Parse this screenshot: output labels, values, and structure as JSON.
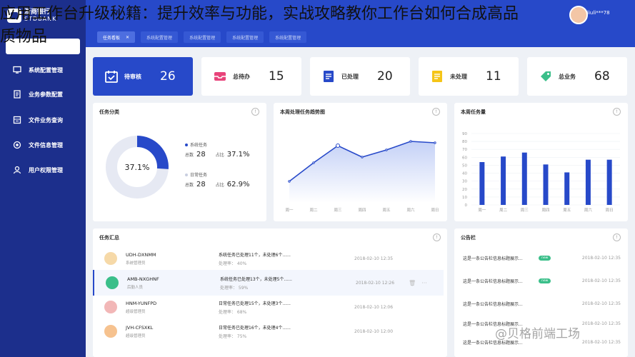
{
  "headline": {
    "line1": "应用工作台升级秘籍：提升效率与功能，实战攻略教你工作台如何合成高品",
    "line2": "质物品"
  },
  "brand": {
    "name_cn": "浙商银行",
    "name_en": "STDBANK"
  },
  "sidebar": {
    "items": [
      {
        "label": "系统配置管理",
        "icon": "monitor-icon"
      },
      {
        "label": "业务参数配置",
        "icon": "document-icon"
      },
      {
        "label": "文件业务查询",
        "icon": "folder-icon"
      },
      {
        "label": "文件信息管理",
        "icon": "target-icon"
      },
      {
        "label": "用户权限管理",
        "icon": "user-icon"
      }
    ]
  },
  "tabs": [
    {
      "label": "任务看板",
      "close": "✕"
    },
    {
      "label": "系统配置管理"
    },
    {
      "label": "系统配置管理"
    },
    {
      "label": "系统配置管理"
    },
    {
      "label": "系统配置管理"
    }
  ],
  "user": {
    "name": "liuli***78"
  },
  "stats": [
    {
      "label": "待审核",
      "value": "26",
      "icon": "check-calendar-icon"
    },
    {
      "label": "总待办",
      "value": "15",
      "icon": "inbox-icon"
    },
    {
      "label": "已处理",
      "value": "20",
      "icon": "processed-icon"
    },
    {
      "label": "未处理",
      "value": "11",
      "icon": "pending-icon"
    },
    {
      "label": "总业务",
      "value": "68",
      "icon": "tag-icon"
    }
  ],
  "category": {
    "title": "任务分类",
    "center": "37.1%",
    "groups": [
      {
        "name": "系统任务",
        "total_label": "总数",
        "total": "28",
        "pct_label": "占比",
        "pct": "37.1%"
      },
      {
        "name": "日常任务",
        "total_label": "总数",
        "total": "28",
        "pct_label": "占比",
        "pct": "62.9%"
      }
    ]
  },
  "colors": {
    "primary": "#2749c9",
    "sidebar": "#1c2f8c",
    "donut_rest": "#e6e9f3",
    "success": "#3bbf8a"
  },
  "trend": {
    "title": "本周处理任务趋势图"
  },
  "volume": {
    "title": "本周任务量"
  },
  "chart_data": [
    {
      "type": "area",
      "x": [
        "周一",
        "周二",
        "周三",
        "周四",
        "周五",
        "周六",
        "周日"
      ],
      "values": [
        35,
        48,
        60,
        52,
        57,
        63,
        62
      ]
    },
    {
      "type": "bar",
      "categories": [
        "周一",
        "周二",
        "周三",
        "周四",
        "周五",
        "周六",
        "周日"
      ],
      "values": [
        54,
        61,
        66,
        51,
        41,
        57,
        57
      ],
      "yticks": [
        "0",
        "10",
        "20",
        "30",
        "40",
        "50",
        "60",
        "70",
        "80",
        "90"
      ],
      "ylim": [
        0,
        90
      ]
    }
  ],
  "tasks": {
    "title": "任务汇总",
    "rows": [
      {
        "id": "UDH-DXNMM",
        "role": "系统管理员",
        "msg": "系统任务已处理11个，未处理6个......",
        "progress": "处理率： 40%",
        "time": "2018-02-10  12:35"
      },
      {
        "id": "AMB-NXGHNF",
        "role": "后勤人员",
        "msg": "系统任务已处理13个，未处理5个......",
        "progress": "处理率： 59%",
        "time": "2018-02-10  12:26"
      },
      {
        "id": "HNM-YUNFPD",
        "role": "超级管理员",
        "msg": "日常任务已处理15个，未处理3个......",
        "progress": "处理率： 68%",
        "time": "2018-02-10  12:06"
      },
      {
        "id": "JVH-CFSXKL",
        "role": "超级管理员",
        "msg": "日常任务已处理16个，未处理4个......",
        "progress": "处理率： 75%",
        "time": "2018-02-10  12:00"
      }
    ]
  },
  "notices": {
    "title": "公告栏",
    "items": [
      {
        "text": "这是一条公告栏信息标题展示...",
        "badge": "new",
        "time": "2018-02-10  12:35"
      },
      {
        "text": "这是一条公告栏信息标题展示...",
        "badge": "new",
        "time": "2018-02-10  12:35"
      },
      {
        "text": "这是一条公告栏信息标题展示...",
        "time": "2018-02-10  12:35"
      },
      {
        "text": "这是一条公告栏信息标题展示...",
        "time": "2018-02-10  12:35"
      },
      {
        "text": "这是一条公告栏信息标题展示...",
        "time": "2018-02-10  12:35"
      }
    ]
  },
  "watermark": "@贝格前端工场"
}
